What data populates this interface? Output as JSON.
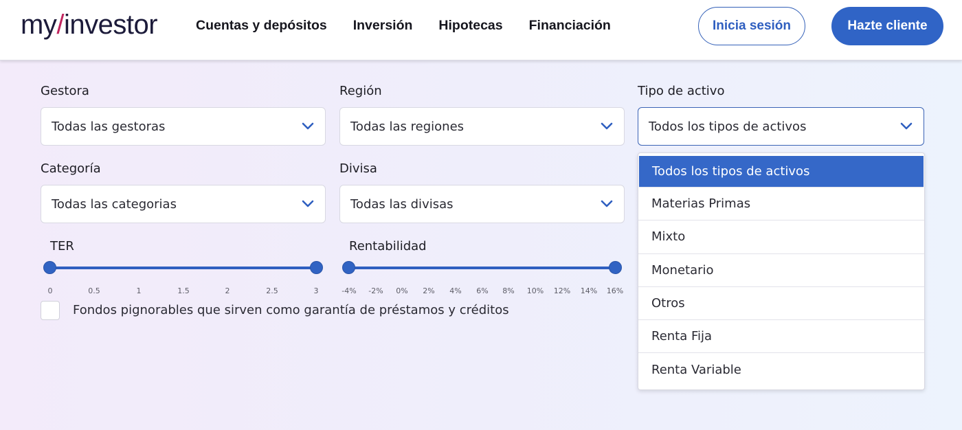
{
  "header": {
    "logo_prefix": "my",
    "logo_slash": "/",
    "logo_suffix": "investor",
    "nav": [
      "Cuentas y depósitos",
      "Inversión",
      "Hipotecas",
      "Financiación"
    ],
    "login_label": "Inicia sesión",
    "signup_label": "Hazte cliente"
  },
  "filters": {
    "gestora": {
      "label": "Gestora",
      "value": "Todas las gestoras"
    },
    "region": {
      "label": "Región",
      "value": "Todas las regiones"
    },
    "tipo": {
      "label": "Tipo de activo",
      "value": "Todos los tipos de activos"
    },
    "categoria": {
      "label": "Categoría",
      "value": "Todas las categorias"
    },
    "divisa": {
      "label": "Divisa",
      "value": "Todas las divisas"
    }
  },
  "ter": {
    "label": "TER",
    "ticks": [
      "0",
      "0.5",
      "1",
      "1.5",
      "2",
      "2.5",
      "3"
    ],
    "range": [
      0,
      3
    ]
  },
  "rentabilidad": {
    "label": "Rentabilidad",
    "ticks": [
      "-4%",
      "-2%",
      "0%",
      "2%",
      "4%",
      "6%",
      "8%",
      "10%",
      "12%",
      "14%",
      "16%"
    ],
    "range": [
      "-4%",
      "16%"
    ]
  },
  "pignorable": {
    "label": "Fondos pignorables que sirven como garantía de préstamos y créditos",
    "checked": false
  },
  "tipo_options": [
    "Todos los tipos de activos",
    "Materias Primas",
    "Mixto",
    "Monetario",
    "Otros",
    "Renta Fija",
    "Renta Variable"
  ],
  "colors": {
    "accent": "#3064c6",
    "slider": "#2f5fc0",
    "selected_option": "#3568c8"
  }
}
